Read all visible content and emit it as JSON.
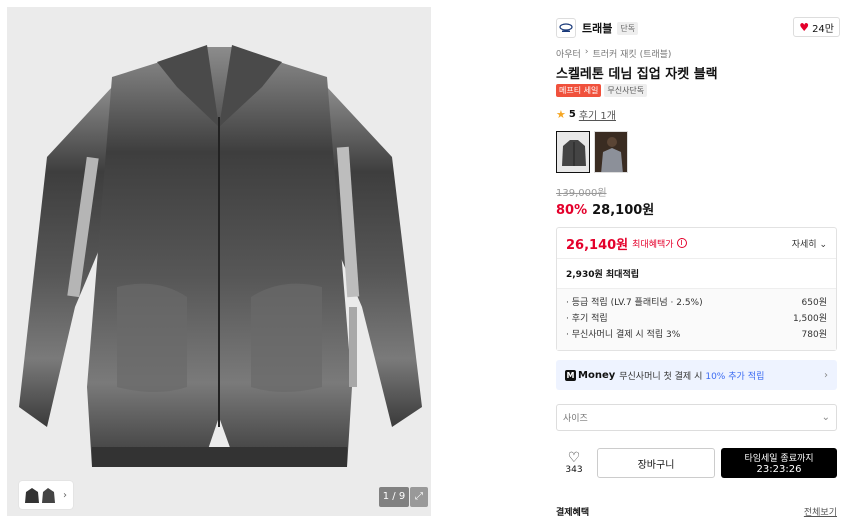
{
  "gallery": {
    "counter": "1 / 9",
    "thumb_icon": "jacket-thumbnail-icon",
    "expand_icon": "expand-icon"
  },
  "brand": {
    "name": "트래블",
    "badge": "단독",
    "likes": "24만",
    "logo_icon": "brand-logo-icon",
    "heart_icon": "heart-icon"
  },
  "breadcrumb": [
    "아우터",
    "트러커 재킷 (트래블)"
  ],
  "product": {
    "title": "스켈레톤 데님 집업 자켓 블랙",
    "tags": [
      "메프티 세일",
      "무신사단독"
    ],
    "rating": "5",
    "reviews": "후기 1개",
    "original_price": "139,000원",
    "discount": "80%",
    "price": "28,100원"
  },
  "benefits": {
    "max_price": "26,140원",
    "max_label": "최대혜택가",
    "detail_label": "자세히",
    "points_total": "2,930원 최대적립",
    "rows": [
      {
        "label": "· 등급 적립 (LV.7 플래티넘 · 2.5%)",
        "amount": "650원"
      },
      {
        "label": "· 후기 적립",
        "amount": "1,500원"
      },
      {
        "label": "· 무신사머니 결제 시 적립 3%",
        "amount": "780원"
      }
    ]
  },
  "money": {
    "logo": "Money",
    "text": "무신사머니 첫 결제 시",
    "highlight": "10% 추가",
    "tail": "적립"
  },
  "size": {
    "placeholder": "사이즈"
  },
  "actions": {
    "wish_count": "343",
    "cart_label": "장바구니",
    "buy_label": "타임세일 종료까지",
    "timer": "23:23:26"
  },
  "payment": {
    "title": "결제혜택",
    "more": "전체보기"
  },
  "colors": {
    "accent_red": "#e4002b",
    "money_blue": "#3b6bf2"
  }
}
